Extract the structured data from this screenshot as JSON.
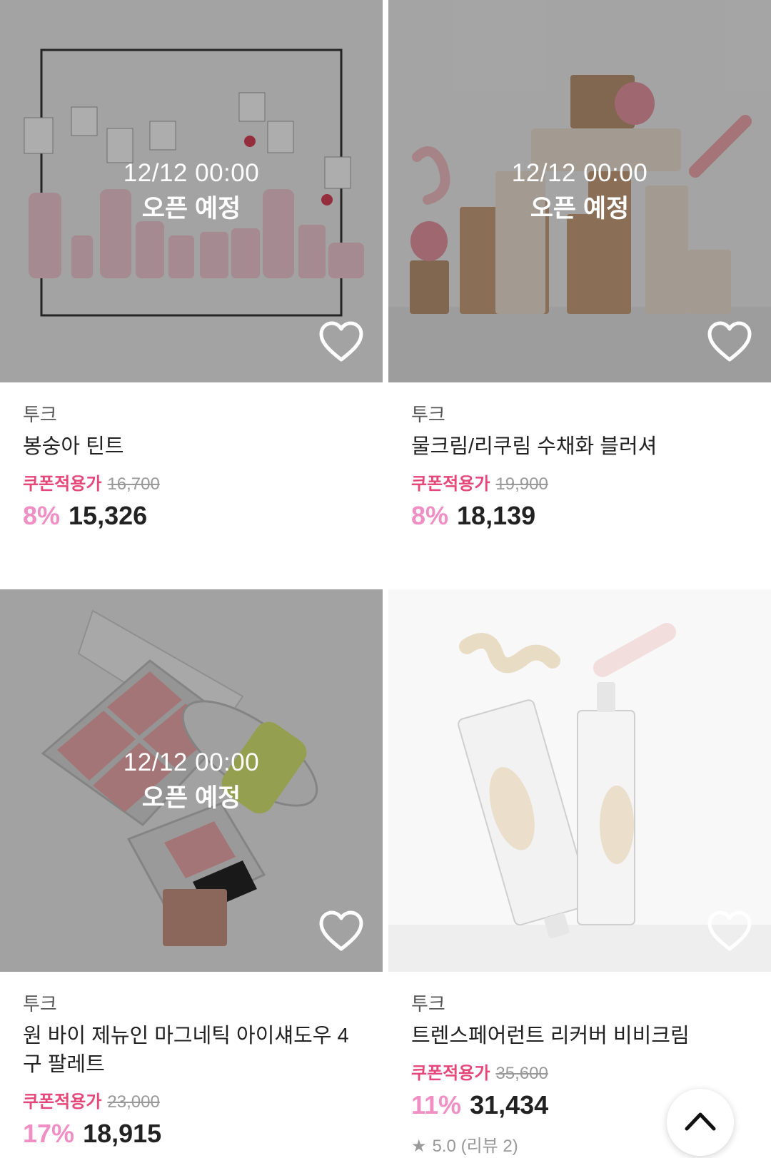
{
  "products": [
    {
      "brand": "투크",
      "name": "봉숭아 틴트",
      "open_time": "12/12 00:00",
      "open_label": "오픈 예정",
      "coupon_label": "쿠폰적용가",
      "original_price": "16,700",
      "discount_rate": "8%",
      "final_price": "15,326",
      "image_icon": "tint-product-image"
    },
    {
      "brand": "투크",
      "name": "물크림/리쿠림 수채화 블러셔",
      "open_time": "12/12 00:00",
      "open_label": "오픈 예정",
      "coupon_label": "쿠폰적용가",
      "original_price": "19,900",
      "discount_rate": "8%",
      "final_price": "18,139",
      "image_icon": "blusher-product-image"
    },
    {
      "brand": "투크",
      "name": "원 바이 제뉴인 마그네틱 아이섀도우 4구 팔레트",
      "open_time": "12/12 00:00",
      "open_label": "오픈 예정",
      "coupon_label": "쿠폰적용가",
      "original_price": "23,000",
      "discount_rate": "17%",
      "final_price": "18,915",
      "image_icon": "palette-product-image"
    },
    {
      "brand": "투크",
      "name": "트렌스페어런트 리커버 비비크림",
      "coupon_label": "쿠폰적용가",
      "original_price": "35,600",
      "discount_rate": "11%",
      "final_price": "31,434",
      "rating": "5.0",
      "review_text": "(리뷰 2)",
      "image_icon": "bb-cream-product-image"
    }
  ],
  "colors": {
    "coupon": "#e6477a",
    "discount": "#ef8fc3"
  },
  "scroll_top_icon": "chevron-up-icon"
}
